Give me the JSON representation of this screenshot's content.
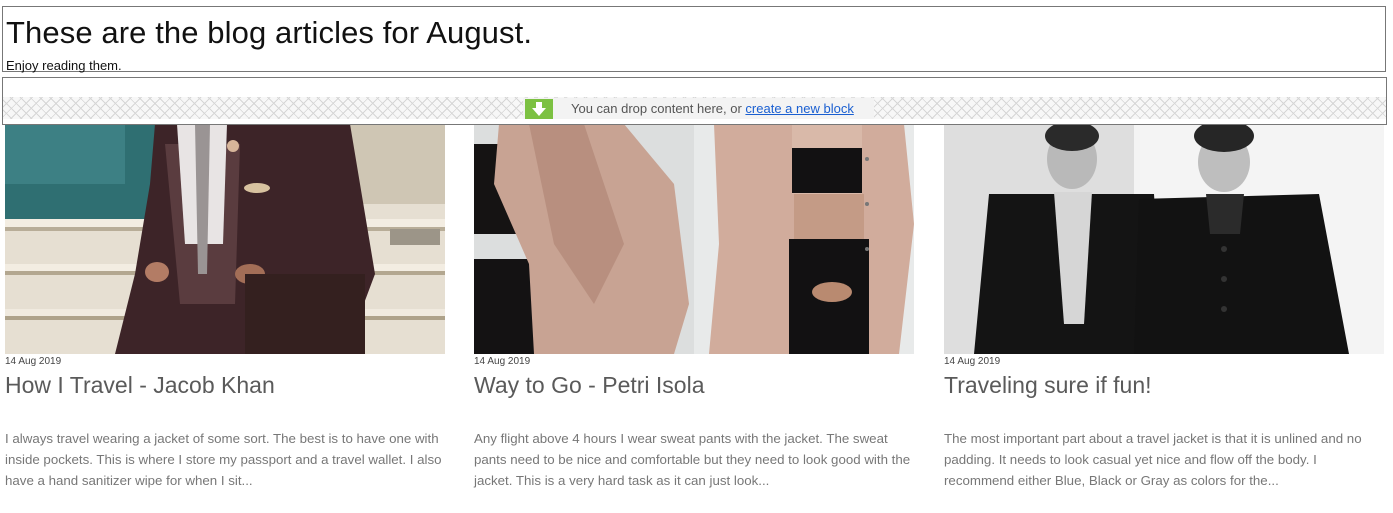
{
  "header": {
    "title": "These are the blog articles for August.",
    "subtitle": "Enjoy reading them."
  },
  "drop_zone": {
    "message": "You can drop content here, or ",
    "link_text": "create a new block",
    "icon": "download-arrow-icon",
    "icon_color": "#7cc142"
  },
  "posts": [
    {
      "date": "14 Aug 2019",
      "title": "How I Travel - Jacob Khan",
      "excerpt": "I always travel wearing a jacket of some sort. The best is to have one with inside pockets. This is where I store my passport and a travel wallet. I also have a hand sanitizer wipe for when I sit...",
      "image": "man-in-suit-sitting-on-steps-photo"
    },
    {
      "date": "14 Aug 2019",
      "title": "Way to Go - Petri Isola",
      "excerpt": "Any flight above 4 hours I wear sweat pants with the jacket. The sweat pants need to be nice and comfortable but they need to look good with the jacket. This is a very hard task as it can just look...",
      "image": "two-women-in-pink-jackets-photo"
    },
    {
      "date": "14 Aug 2019",
      "title": "Traveling sure if fun!",
      "excerpt": "The most important part about a travel jacket is that it is unlined and no padding. It needs to look casual yet nice and flow off the body. I recommend either Blue, Black or Gray as colors for the...",
      "image": "two-men-in-black-coats-photo"
    }
  ]
}
